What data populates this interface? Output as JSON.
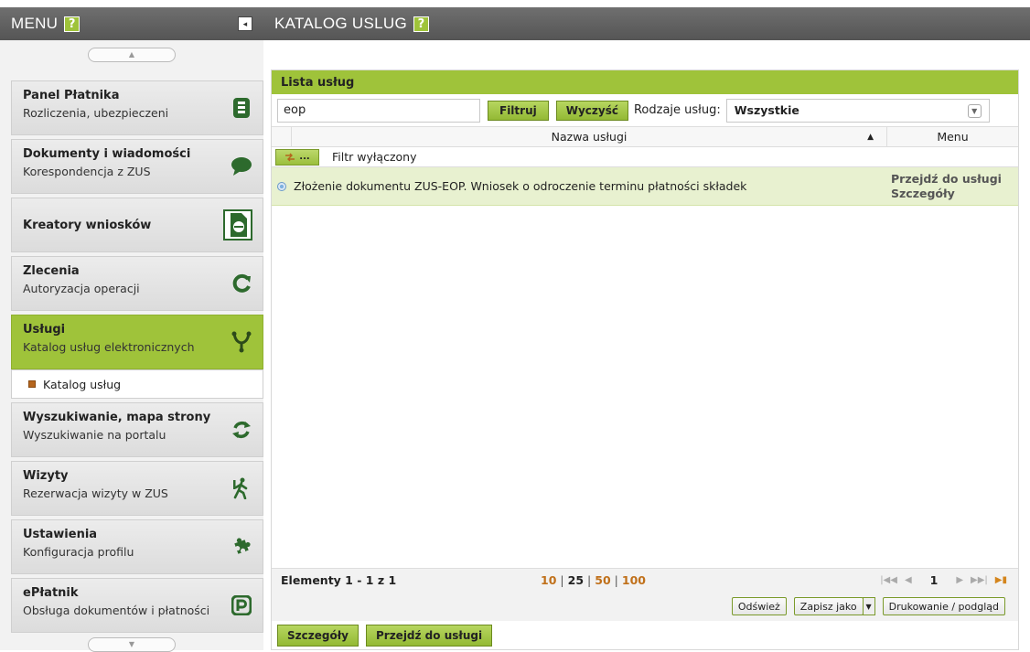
{
  "sidebar": {
    "title": "MENU",
    "help": "?",
    "collapse_glyph": "◂",
    "scroll_up": "▲",
    "scroll_down": "▼",
    "items": [
      {
        "title": "Panel Płatnika",
        "subtitle": "Rozliczenia, ubezpieczeni",
        "icon": "payer-panel-icon"
      },
      {
        "title": "Dokumenty i wiadomości",
        "subtitle": "Korespondencja z ZUS",
        "icon": "speech-bubble-icon"
      },
      {
        "title": "Kreatory wniosków",
        "subtitle": "",
        "icon": "document-wizard-icon"
      },
      {
        "title": "Zlecenia",
        "subtitle": "Autoryzacja operacji",
        "icon": "refresh-arrow-icon"
      },
      {
        "title": "Usługi",
        "subtitle": "Katalog usług elektronicznych",
        "icon": "services-icon",
        "active": true
      },
      {
        "title": "Wyszukiwanie, mapa strony",
        "subtitle": "Wyszukiwanie na portalu",
        "icon": "sync-icon"
      },
      {
        "title": "Wizyty",
        "subtitle": "Rezerwacja wizyty w ZUS",
        "icon": "walking-person-icon"
      },
      {
        "title": "Ustawienia",
        "subtitle": "Konfiguracja profilu",
        "icon": "puzzle-icon"
      },
      {
        "title": "ePłatnik",
        "subtitle": "Obsługa dokumentów i płatności",
        "icon": "epayer-icon"
      }
    ],
    "submenu_item": "Katalog usług"
  },
  "main": {
    "title": "KATALOG USLUG",
    "help": "?",
    "panel_title": "Lista usług",
    "filter": {
      "value": "eop",
      "filter_button": "Filtruj",
      "clear_button": "Wyczyść",
      "type_label": "Rodzaje usług:",
      "type_value": "Wszystkie"
    },
    "columns": {
      "name": "Nazwa usługi",
      "menu": "Menu"
    },
    "filter_status_button": "...",
    "filter_status": "Filtr wyłączony",
    "rows": [
      {
        "name": "Złożenie dokumentu ZUS-EOP. Wniosek o odroczenie terminu płatności składek",
        "link1": "Przejdź do usługi",
        "link2": "Szczegóły"
      }
    ],
    "pager": {
      "count": "Elementy 1 - 1 z 1",
      "sizes": [
        "10",
        "25",
        "50",
        "100"
      ],
      "page": "1"
    },
    "actions": {
      "refresh": "Odśwież",
      "save_as": "Zapisz jako",
      "print": "Drukowanie / podgląd"
    },
    "bottom": {
      "details": "Szczegóły",
      "go": "Przejdź do usługi"
    }
  },
  "colors": {
    "accent": "#9fc33a",
    "header": "#5f5f5f",
    "row_selected": "#e8f1d0"
  }
}
